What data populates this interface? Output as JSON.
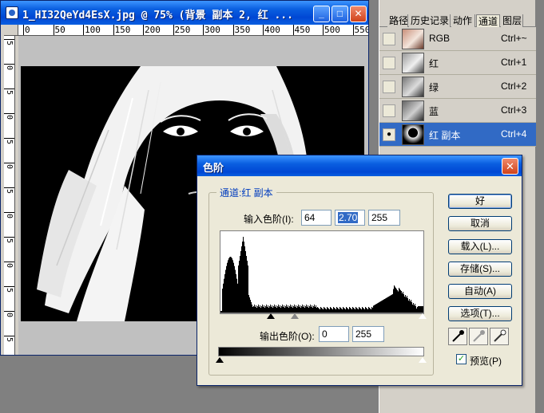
{
  "document": {
    "title": "1_HI32QeYd4EsX.jpg @ 75% (背景 副本 2, 红 ...",
    "ruler_h": [
      "0",
      "50",
      "100",
      "150",
      "200",
      "250",
      "300",
      "350",
      "400",
      "450",
      "500",
      "550"
    ],
    "ruler_v": [
      "5",
      "0",
      "5",
      "0",
      "5",
      "0",
      "5",
      "0",
      "5",
      "0",
      "5",
      "0",
      "5"
    ]
  },
  "panel": {
    "tabs": [
      "路径",
      "历史记录",
      "动作",
      "通道",
      "图层"
    ],
    "active_tab": "通道",
    "channels": [
      {
        "name": "RGB",
        "shortcut": "Ctrl+~",
        "visible": false,
        "selected": false
      },
      {
        "name": "红",
        "shortcut": "Ctrl+1",
        "visible": false,
        "selected": false
      },
      {
        "name": "绿",
        "shortcut": "Ctrl+2",
        "visible": false,
        "selected": false
      },
      {
        "name": "蓝",
        "shortcut": "Ctrl+3",
        "visible": false,
        "selected": false
      },
      {
        "name": "红 副本",
        "shortcut": "Ctrl+4",
        "visible": true,
        "selected": true
      }
    ]
  },
  "levels": {
    "title": "色阶",
    "channel_label": "通道:红 副本",
    "input_label": "输入色阶(I):",
    "input_black": "64",
    "input_gamma": "2.70",
    "input_white": "255",
    "output_label": "输出色阶(O):",
    "output_black": "0",
    "output_white": "255",
    "buttons": {
      "ok": "好",
      "cancel": "取消",
      "load": "载入(L)...",
      "save": "存储(S)...",
      "auto": "自动(A)",
      "options": "选项(T)..."
    },
    "preview_label": "预览(P)",
    "preview_checked": true
  },
  "colors": {
    "titlebar": "#0a5fe0",
    "selection": "#316ac5",
    "dialog_bg": "#ece9d8",
    "group_label": "#003cbe"
  }
}
